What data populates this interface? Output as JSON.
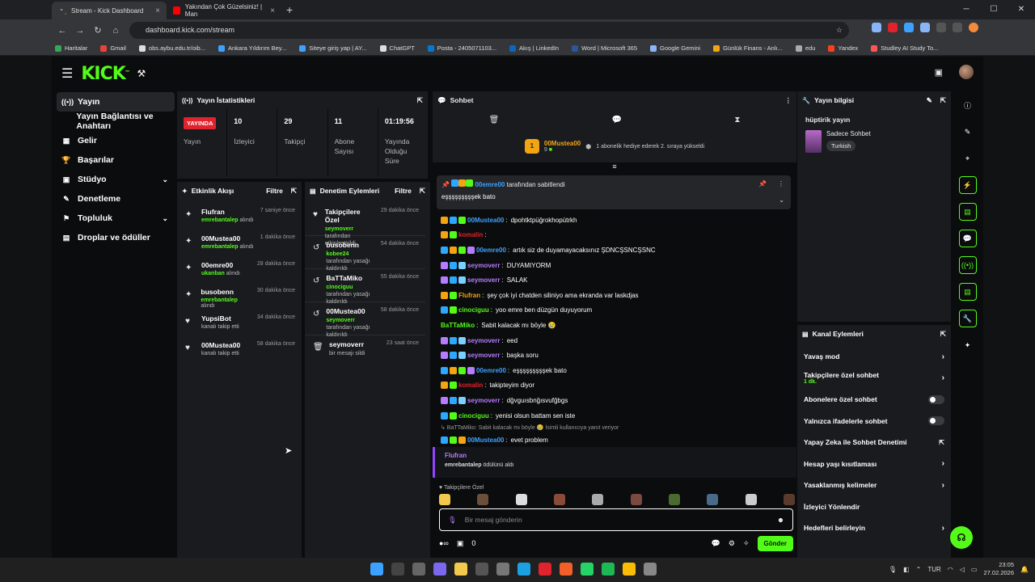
{
  "browser": {
    "tabs": [
      {
        "label": "Stream - Kick Dashboard",
        "color": "#53fc18"
      },
      {
        "label": "Yakından Çok Güzelsiniz! | Man",
        "color": "#ff0000"
      }
    ],
    "url": "dashboard.kick.com/stream",
    "new_tab": "+",
    "win": [
      "─",
      "☐",
      "✕"
    ]
  },
  "bookmarks": [
    {
      "label": "Haritalar",
      "c": "#34a853"
    },
    {
      "label": "Gmail",
      "c": "#ea4335"
    },
    {
      "label": "obs.aybu.edu.tr/oib...",
      "c": "#ddd"
    },
    {
      "label": "Ankara Yıldırım Bey...",
      "c": "#3da2ff"
    },
    {
      "label": "Siteye giriş yap | AY...",
      "c": "#3da2ff"
    },
    {
      "label": "ChatGPT",
      "c": "#ddd"
    },
    {
      "label": "Posta - 2405071103...",
      "c": "#0078d4"
    },
    {
      "label": "Akış | LinkedIn",
      "c": "#0a66c2"
    },
    {
      "label": "Word | Microsoft 365",
      "c": "#2b579a"
    },
    {
      "label": "Google Gemini",
      "c": "#8ab4f8"
    },
    {
      "label": "Günlük Finans - Anlı...",
      "c": "#f2a413"
    },
    {
      "label": "edu",
      "c": "#aaa"
    },
    {
      "label": "Yandex",
      "c": "#fc3f1d"
    },
    {
      "label": "Studley AI Study To...",
      "c": "#ff5555"
    }
  ],
  "nav": {
    "logo": "KICK",
    "items": [
      {
        "label": "Yayın",
        "icon": "((•))",
        "active": true
      },
      {
        "label": "Yayın Bağlantısı ve Anahtarı",
        "icon": ""
      },
      {
        "label": "Gelir",
        "icon": "▦"
      },
      {
        "label": "Başarılar",
        "icon": "🏆"
      },
      {
        "label": "Stüdyo",
        "icon": "▣",
        "chev": "⌄"
      },
      {
        "label": "Denetleme",
        "icon": "✎"
      },
      {
        "label": "Topluluk",
        "icon": "⚑",
        "chev": "⌄"
      },
      {
        "label": "Droplar ve ödüller",
        "icon": "▤"
      }
    ]
  },
  "stats": {
    "title": "Yayın İstatistikleri",
    "live": "YAYINDA",
    "items": [
      {
        "v": "",
        "l": "Yayın"
      },
      {
        "v": "10",
        "l": "İzleyici"
      },
      {
        "v": "29",
        "l": "Takipçi"
      },
      {
        "v": "11",
        "l": "Abone Sayısı"
      },
      {
        "v": "01:19:56",
        "l": "Yayında Olduğu Süre"
      }
    ]
  },
  "activity": {
    "title": "Etkinlik Akışı",
    "filter": "Filtre",
    "items": [
      {
        "name": "Flufran",
        "sub_user": "emrebantalep",
        "sub": "alındı",
        "time": "7 saniye önce",
        "icon": "✦"
      },
      {
        "name": "00Mustea00",
        "sub_user": "emrebantalep",
        "sub": "alındı",
        "time": "1 dakika önce",
        "icon": "✦"
      },
      {
        "name": "00emre00",
        "sub_user": "ukanban",
        "sub": "alındı",
        "time": "28 dakika önce",
        "icon": "✦"
      },
      {
        "name": "busobenn",
        "sub_user": "emrebantalep",
        "sub": "alındı",
        "time": "30 dakika önce",
        "icon": "✦"
      },
      {
        "name": "YupsiBot",
        "sub_user": "",
        "sub": "kanalı takip etti",
        "time": "34 dakika önce",
        "icon": "♥"
      },
      {
        "name": "00Mustea00",
        "sub_user": "",
        "sub": "kanalı takip etti",
        "time": "58 dakika önce",
        "icon": "♥"
      }
    ]
  },
  "moderation": {
    "title": "Denetim Eylemleri",
    "filter": "Filtre",
    "items": [
      {
        "name": "Takipçilere Özel",
        "sub_user": "seymoverr",
        "sub": "tarafından etkinleştirildi",
        "time": "29 dakika önce",
        "icon": "♥"
      },
      {
        "name": "busobenn",
        "sub_user": "kobee24",
        "sub": "tarafından yasağı kaldırıldı",
        "time": "54 dakika önce",
        "icon": "↺"
      },
      {
        "name": "BaTTaMiko",
        "sub_user": "cinociguu",
        "sub": "tarafından yasağı kaldırıldı",
        "time": "55 dakika önce",
        "icon": "↺"
      },
      {
        "name": "00Mustea00",
        "sub_user": "seymoverr",
        "sub": "tarafından yasağı kaldırıldı",
        "time": "58 dakika önce",
        "icon": "↺"
      },
      {
        "name": "seymoverr",
        "sub_user": "",
        "sub": "bir mesajı sildi",
        "time": "23 saat önce",
        "icon": "🗑"
      }
    ]
  },
  "chat": {
    "title": "Sohbet",
    "gift_user": "00Mustea00",
    "gift_count": "9",
    "gift_text": "1 abonelik hediye ederek 2. sıraya yükseldi",
    "pinned": {
      "by": "00emre00",
      "by_text": "tarafından sabitlendi",
      "msg": "eşşşşşşşşşek bato"
    },
    "messages": [
      {
        "user": "00Mustea00",
        "color": "#3da2ff",
        "text": "dpohtktpüğrokhopütrkh",
        "badges": [
          "#f2a413",
          "#2ea8ff",
          "#53fc18"
        ]
      },
      {
        "user": "komalin",
        "color": "#e1232d",
        "text": "",
        "badges": [
          "#f2a413",
          "#53fc18"
        ]
      },
      {
        "user": "00emre00",
        "color": "#3da2ff",
        "text": "artık siz de duyamayacaksınız ŞDNCŞSNCŞSNC",
        "badges": [
          "#2ea8ff",
          "#f2a413",
          "#53fc18",
          "#b57cff"
        ]
      },
      {
        "user": "seymoverr",
        "color": "#b57cff",
        "text": "DUYAMIYORM",
        "badges": [
          "#b57cff",
          "#2ea8ff",
          "#7ad0ff"
        ]
      },
      {
        "user": "seymoverr",
        "color": "#b57cff",
        "text": "SALAK",
        "badges": [
          "#b57cff",
          "#2ea8ff",
          "#7ad0ff"
        ]
      },
      {
        "user": "Flufran",
        "color": "#f2a413",
        "text": "şey çok iyi chatden siliniyo ama ekranda var laskdjas",
        "badges": [
          "#f2a413",
          "#53fc18"
        ]
      },
      {
        "user": "cinociguu",
        "color": "#53fc18",
        "text": "yoo emre ben düzgün duyuyorum",
        "badges": [
          "#2ea8ff",
          "#53fc18"
        ]
      },
      {
        "user": "BaTTaMiko",
        "color": "#53fc18",
        "text": "Sabit kalacak mı böyle 😢",
        "badges": []
      },
      {
        "user": "seymoverr",
        "color": "#b57cff",
        "text": "eed",
        "badges": [
          "#b57cff",
          "#2ea8ff",
          "#7ad0ff"
        ]
      },
      {
        "user": "seymoverr",
        "color": "#b57cff",
        "text": "başka soru",
        "badges": [
          "#b57cff",
          "#2ea8ff",
          "#7ad0ff"
        ]
      },
      {
        "user": "00emre00",
        "color": "#3da2ff",
        "text": "eşşşşşşşşşek bato",
        "badges": [
          "#2ea8ff",
          "#f2a413",
          "#53fc18",
          "#b57cff"
        ]
      },
      {
        "user": "komalin",
        "color": "#e1232d",
        "text": "takipteyim diyor",
        "badges": [
          "#f2a413",
          "#53fc18"
        ]
      },
      {
        "user": "seymoverr",
        "color": "#b57cff",
        "text": "dğvguısbnğısvufğbgs",
        "badges": [
          "#b57cff",
          "#2ea8ff",
          "#7ad0ff"
        ]
      },
      {
        "user": "cinociguu",
        "color": "#53fc18",
        "text": "yenisi olsun battam sen iste",
        "badges": [
          "#2ea8ff",
          "#53fc18"
        ]
      }
    ],
    "reply": "↳ BaTTaMiko: Sabit kalacak mı böyle 😢 İsimli kullanıcıya yanıt veriyor",
    "last": {
      "user": "00Mustea00",
      "color": "#3da2ff",
      "text": "evet problem",
      "badges": [
        "#2ea8ff",
        "#53fc18",
        "#f2a413"
      ]
    },
    "system": {
      "user": "Flufran",
      "sub_user": "emrebantalep",
      "sub": "ödülünü aldı"
    },
    "follower_only": "♥ Takipçilere Özel",
    "placeholder": "Bir mesaj gönderin",
    "count": "0",
    "send": "Gönder"
  },
  "info": {
    "title": "Yayın bilgisi",
    "stream_title": "hüptirik yayın",
    "category": "Sadece Sohbet",
    "tag": "Turkish"
  },
  "actions": {
    "title": "Kanal Eylemleri",
    "rows": [
      {
        "label": "Yavaş mod",
        "type": "arrow"
      },
      {
        "label": "Takipçilere özel sohbet",
        "sub": "1 dk.",
        "type": "arrow"
      },
      {
        "label": "Abonelere özel sohbet",
        "type": "toggle"
      },
      {
        "label": "Yalnızca ifadelerle sohbet",
        "type": "toggle"
      },
      {
        "label": "Yapay Zeka ile Sohbet Denetimi",
        "type": "ext"
      },
      {
        "label": "Hesap yaşı kısıtlaması",
        "type": "arrow"
      },
      {
        "label": "Yasaklanmış kelimeler",
        "type": "arrow"
      },
      {
        "label": "İzleyici Yönlendir",
        "type": "none"
      },
      {
        "label": "Hedefleri belirleyin",
        "type": "arrow"
      }
    ]
  },
  "taskbar": {
    "time": "23:05",
    "date": "27.02.2026",
    "lang": "TUR"
  }
}
